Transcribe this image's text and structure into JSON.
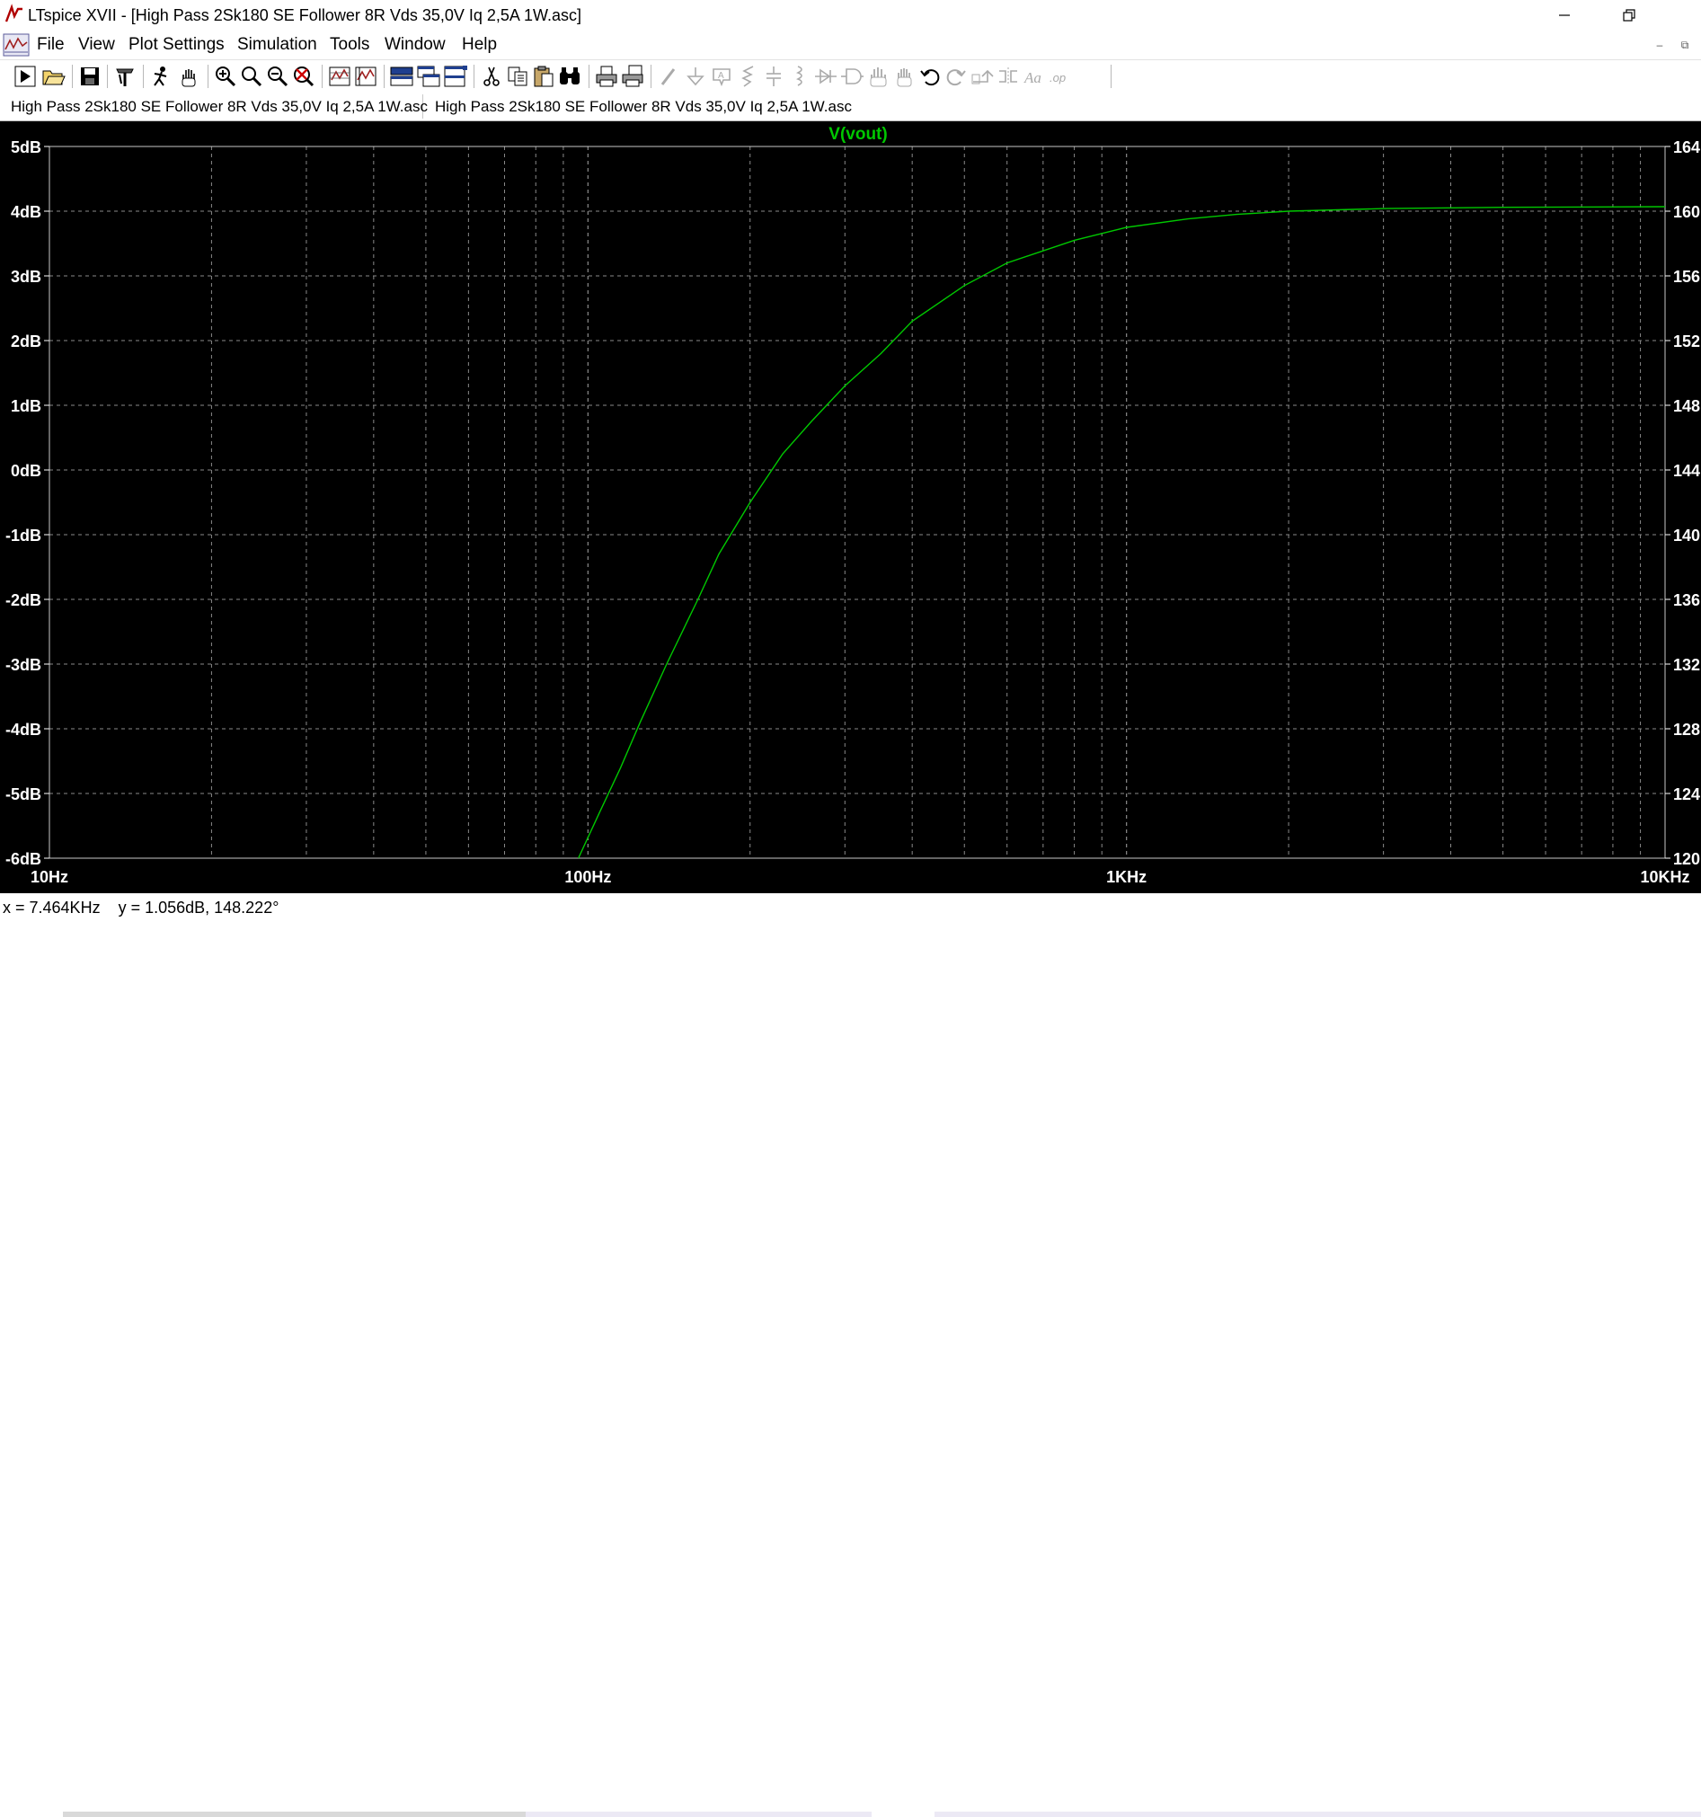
{
  "window": {
    "title": "LTspice XVII - [High Pass 2Sk180 SE Follower 8R Vds 35,0V Iq 2,5A 1W.asc]",
    "minimize_icon": "minimize-icon",
    "restore_icon": "restore-icon"
  },
  "menu": {
    "items": [
      {
        "label": "File"
      },
      {
        "label": "View"
      },
      {
        "label": "Plot Settings"
      },
      {
        "label": "Simulation"
      },
      {
        "label": "Tools"
      },
      {
        "label": "Window"
      },
      {
        "label": "Help"
      }
    ],
    "mdi_min": "–",
    "mdi_restore": "⧉"
  },
  "toolbar": {
    "icons": [
      "run-icon",
      "open-icon",
      "save-icon",
      "control-panel-icon",
      "halt-icon",
      "pan-icon",
      "zoom-in-icon",
      "zoom-area-icon",
      "zoom-out-icon",
      "zoom-cancel-icon",
      "autorange-icon",
      "tile-icon",
      "cascade-icon",
      "tile-horizontal-icon",
      "tile-vertical-icon",
      "cut-icon",
      "copy-icon",
      "paste-icon",
      "find-icon",
      "print-icon",
      "print-preview-icon",
      "wire-icon",
      "ground-icon",
      "label-icon",
      "resistor-icon",
      "capacitor-icon",
      "inductor-icon",
      "diode-icon",
      "component-icon",
      "move-icon",
      "drag-icon",
      "undo-icon",
      "redo-icon",
      "rotate-icon",
      "mirror-icon",
      "text-icon",
      "spice-directive-icon"
    ]
  },
  "tabs": [
    {
      "label": "High Pass 2Sk180 SE Follower 8R Vds 35,0V Iq 2,5A 1W.asc",
      "icon": "waveform-tab-icon",
      "active": true
    },
    {
      "label": "High Pass 2Sk180 SE Follower 8R Vds 35,0V Iq 2,5A 1W.asc",
      "icon": "schematic-tab-icon",
      "active": false
    }
  ],
  "plot": {
    "background": "#000000",
    "grid_color": "#8a8a8a",
    "trace_color": "#00c800",
    "label_color": "#ffffff"
  },
  "chart_data": {
    "type": "line",
    "title": "V(vout)",
    "x_scale": "log",
    "xlim": [
      10,
      10000
    ],
    "x_ticks": [
      "10Hz",
      "100Hz",
      "1KHz",
      "10KHz"
    ],
    "x_tick_values": [
      10,
      100,
      1000,
      10000
    ],
    "ylim": [
      -6,
      5
    ],
    "y_ticks": [
      "5dB",
      "4dB",
      "3dB",
      "2dB",
      "1dB",
      "0dB",
      "-1dB",
      "-2dB",
      "-3dB",
      "-4dB",
      "-5dB",
      "-6dB"
    ],
    "y_tick_values": [
      5,
      4,
      3,
      2,
      1,
      0,
      -1,
      -2,
      -3,
      -4,
      -5,
      -6
    ],
    "y2_ticks": [
      "164",
      "160",
      "156",
      "152",
      "148",
      "144",
      "140",
      "136",
      "132",
      "128",
      "124",
      "120"
    ],
    "grid": true,
    "series": [
      {
        "name": "V(vout)",
        "x": [
          96,
          105,
          115,
          125,
          140,
          160,
          175,
          200,
          230,
          260,
          300,
          350,
          400,
          500,
          600,
          800,
          1000,
          1300,
          1600,
          2000,
          3000,
          5000,
          10000
        ],
        "y": [
          -6.0,
          -5.3,
          -4.6,
          -3.9,
          -3.0,
          -2.0,
          -1.3,
          -0.5,
          0.25,
          0.75,
          1.3,
          1.8,
          2.3,
          2.85,
          3.2,
          3.55,
          3.75,
          3.88,
          3.95,
          4.0,
          4.04,
          4.06,
          4.07
        ]
      }
    ]
  },
  "status": {
    "readout": "x = 7.464KHz    y = 1.056dB, 148.222°"
  }
}
